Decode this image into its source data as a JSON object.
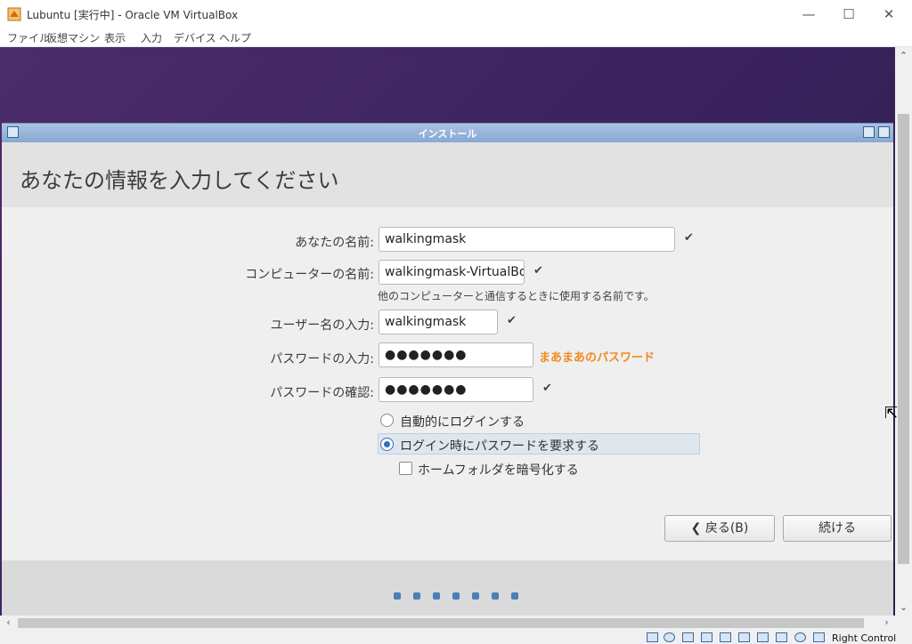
{
  "window": {
    "title": "Lubuntu [実行中] - Oracle VM VirtualBox",
    "controls": {
      "minimize": "—",
      "maximize": "☐",
      "close": "✕"
    }
  },
  "menu": [
    "ファイル",
    "仮想マシン",
    "表示",
    "入力",
    "デバイス",
    "ヘルプ"
  ],
  "dialog": {
    "title": "インストール",
    "heading": "あなたの情報を入力してください",
    "fields": {
      "name_label": "あなたの名前:",
      "name_value": "walkingmask",
      "computer_label": "コンピューターの名前:",
      "computer_value": "walkingmask-VirtualBox",
      "computer_hint": "他のコンピューターと通信するときに使用する名前です。",
      "username_label": "ユーザー名の入力:",
      "username_value": "walkingmask",
      "password_label": "パスワードの入力:",
      "password_value": "●●●●●●●",
      "password_strength": "まあまあのパスワード",
      "confirm_label": "パスワードの確認:",
      "confirm_value": "●●●●●●●"
    },
    "checkmark": "✔",
    "options": {
      "auto_login": "自動的にログインする",
      "require_password": "ログイン時にパスワードを要求する",
      "encrypt_home": "ホームフォルダを暗号化する"
    },
    "buttons": {
      "back": "戻る(B)",
      "back_arrow": "❮",
      "continue": "続ける"
    },
    "progress_dots": 7
  },
  "statusbar": {
    "host_key": "Right Control"
  },
  "colors": {
    "accent": "#2d71b8",
    "strength": "#f08a1e",
    "desktop": "#3c2460"
  },
  "icons": [
    "app-icon",
    "minimize-icon",
    "maximize-icon",
    "close-icon",
    "checkmark-icon",
    "back-arrow-icon",
    "mouse-cursor-icon"
  ]
}
